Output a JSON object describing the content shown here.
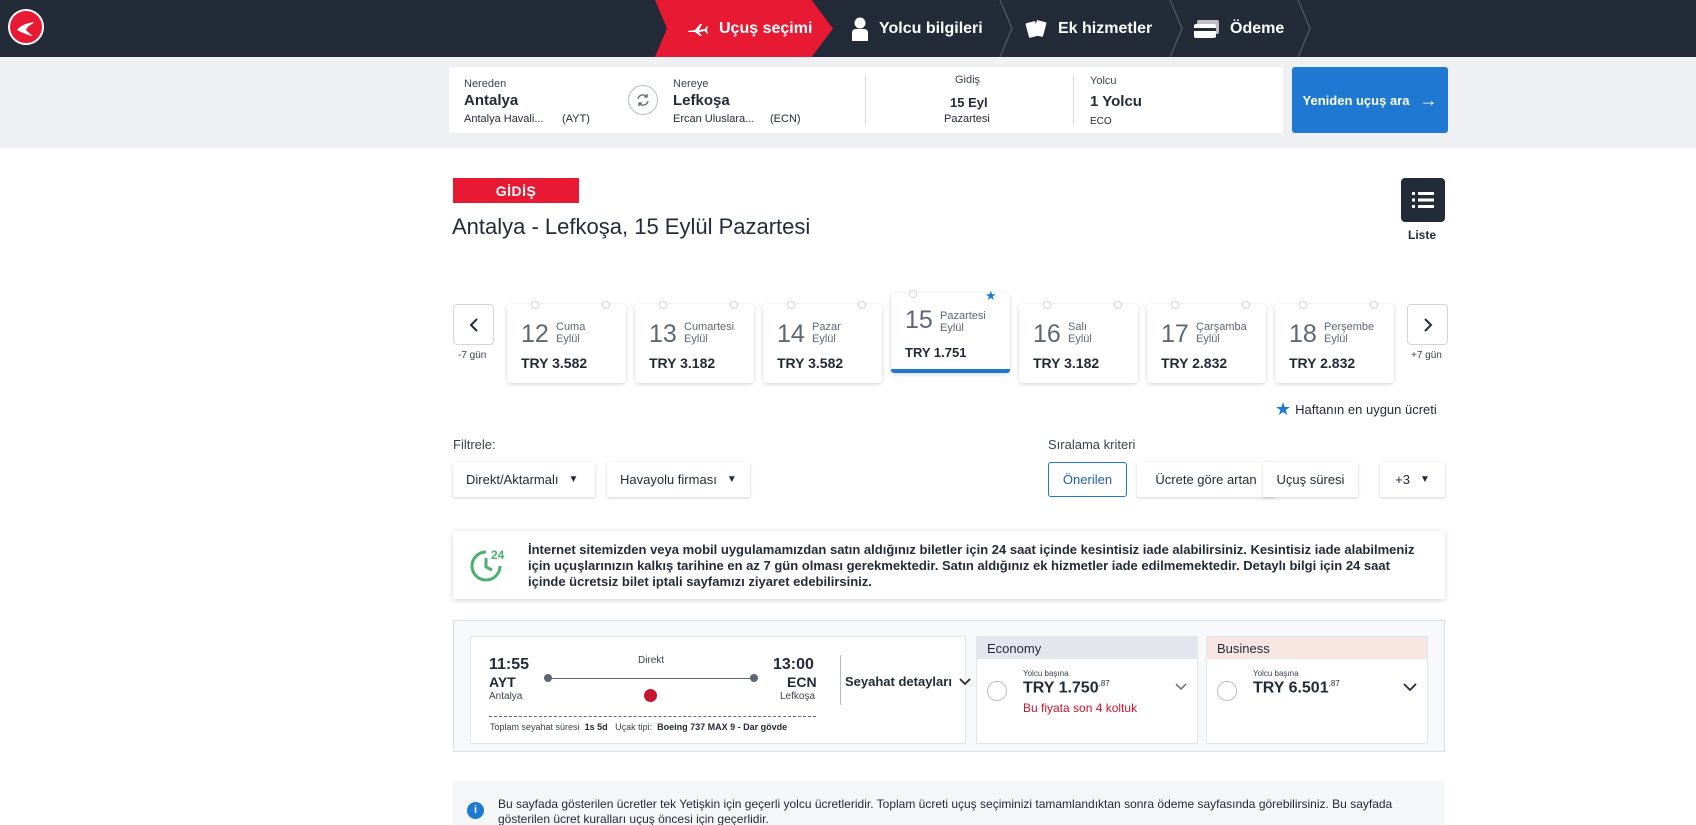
{
  "header": {
    "steps": [
      {
        "label": "Uçuş seçimi",
        "active": true
      },
      {
        "label": "Yolcu bilgileri",
        "active": false
      },
      {
        "label": "Ek hizmetler",
        "active": false
      },
      {
        "label": "Ödeme",
        "active": false
      }
    ],
    "accent": "#e81932",
    "background": "#232b38"
  },
  "search": {
    "from_label": "Nereden",
    "from_city": "Antalya",
    "from_airport": "Antalya Havali...",
    "from_code": "(AYT)",
    "to_label": "Nereye",
    "to_city": "Lefkoşa",
    "to_airport": "Ercan Uluslara...",
    "to_code": "(ECN)",
    "date_label": "Gidiş",
    "date_value": "15 Eyl",
    "date_day": "Pazartesi",
    "pax_label": "Yolcu",
    "pax_value": "1 Yolcu",
    "pax_class": "ECO",
    "search_button": "Yeniden uçuş ara"
  },
  "heading": {
    "badge": "GİDİŞ",
    "route": "Antalya - Lefkoşa, 15 Eylül Pazartesi",
    "list_label": "Liste"
  },
  "dates": {
    "prev_label": "-7 gün",
    "next_label": "+7 gün",
    "cards": [
      {
        "day": "12",
        "weekday": "Cuma",
        "month": "Eylül",
        "price": "TRY 3.582",
        "selected": false
      },
      {
        "day": "13",
        "weekday": "Cumartesi",
        "month": "Eylül",
        "price": "TRY 3.182",
        "selected": false
      },
      {
        "day": "14",
        "weekday": "Pazar",
        "month": "Eylül",
        "price": "TRY 3.582",
        "selected": false
      },
      {
        "day": "15",
        "weekday": "Pazartesi",
        "month": "Eylül",
        "price": "TRY 1.751",
        "selected": true
      },
      {
        "day": "16",
        "weekday": "Salı",
        "month": "Eylül",
        "price": "TRY 3.182",
        "selected": false
      },
      {
        "day": "17",
        "weekday": "Çarşamba",
        "month": "Eylül",
        "price": "TRY 2.832",
        "selected": false
      },
      {
        "day": "18",
        "weekday": "Perşembe",
        "month": "Eylül",
        "price": "TRY 2.832",
        "selected": false
      }
    ],
    "legend": "Haftanın en uygun ücreti"
  },
  "filters": {
    "label": "Filtrele:",
    "direct": "Direkt/Aktarmalı",
    "airline": "Havayolu firması",
    "sort_label": "Sıralama kriteri",
    "sort_recommended": "Önerilen",
    "sort_price": "Ücrete göre artan",
    "sort_duration": "Uçuş süresi",
    "sort_more": "+3"
  },
  "refund_banner": {
    "badge": "24",
    "text": "İnternet sitemizden veya mobil uygulamamızdan satın aldığınız biletler için 24 saat içinde kesintisiz iade alabilirsiniz. Kesintisiz iade alabilmeniz için uçuşlarınızın kalkış tarihine en az 7 gün olması gerekmektedir. Satın aldığınız ek hizmetler iade edilmemektedir. Detaylı bilgi için 24 saat içinde ücretsiz bilet iptali sayfamızı ziyaret edebilirsiniz."
  },
  "flight": {
    "dep_time": "11:55",
    "dep_code": "AYT",
    "dep_city": "Antalya",
    "arr_time": "13:00",
    "arr_code": "ECN",
    "arr_city": "Lefkoşa",
    "stop": "Direkt",
    "total_label": "Toplam seyahat süresi",
    "total_value": "1s 5d",
    "aircraft_label": "Uçak tipi:",
    "aircraft_value": "Boeing 737 MAX 9 - Dar gövde",
    "details": "Seyahat detayları"
  },
  "cabins": [
    {
      "name": "Economy",
      "per": "Yolcu başına",
      "price": "TRY 1.750",
      "cents": ",87",
      "warn": "Bu fiyata son 4 koltuk",
      "color": "#e3e6ec"
    },
    {
      "name": "Business",
      "per": "Yolcu başına",
      "price": "TRY 6.501",
      "cents": ",87",
      "warn": "",
      "color": "#f7e5e1"
    }
  ],
  "note": {
    "icon": "i",
    "text": "Bu sayfada gösterilen ücretler tek Yetişkin için geçerli yolcu ücretleridir. Toplam ücreti uçuş seçiminizi tamamlandıktan sonra ödeme sayfasında görebilirsiniz. Bu sayfada gösterilen ücret kuralları uçuş öncesi için geçerlidir."
  }
}
